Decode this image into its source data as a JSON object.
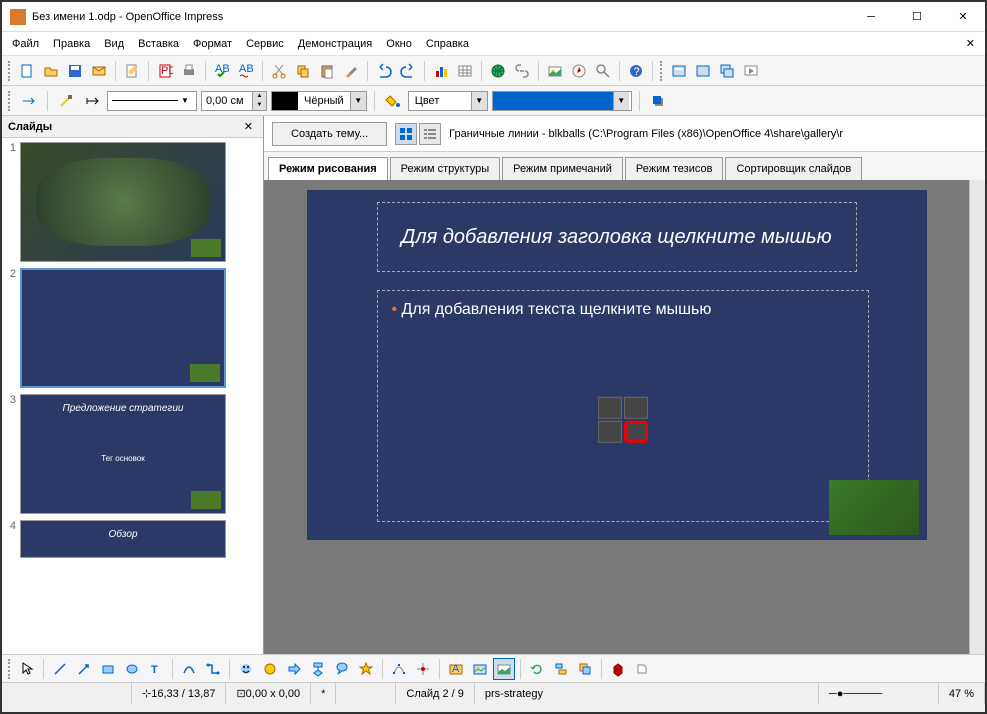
{
  "window": {
    "title": "Без имени 1.odp - OpenOffice Impress"
  },
  "menu": {
    "items": [
      "Файл",
      "Правка",
      "Вид",
      "Вставка",
      "Формат",
      "Сервис",
      "Демонстрация",
      "Окно",
      "Справка"
    ]
  },
  "toolbar1": {
    "icons": [
      "new",
      "open",
      "save",
      "mail",
      "edit",
      "pdf",
      "print",
      "spell",
      "autospell",
      "cut",
      "copy",
      "paste",
      "brush",
      "undo",
      "redo",
      "chart",
      "table",
      "web",
      "hyperlink",
      "gallery",
      "nav",
      "zoom",
      "help",
      "slide1",
      "slide2",
      "slide3",
      "presentation"
    ]
  },
  "toolbar2": {
    "arrow_icon": "arrow-end",
    "line_icon": "line-color",
    "width": "0,00 см",
    "color_label": "Чёрный",
    "bucket_icon": "fill",
    "fill_type": "Цвет",
    "shadow_icon": "shadow"
  },
  "slides_panel": {
    "title": "Слайды"
  },
  "thumbs": [
    {
      "num": "1",
      "type": "image"
    },
    {
      "num": "2",
      "type": "blank",
      "selected": true
    },
    {
      "num": "3",
      "title": "Предложение стратегии",
      "sub": "Тег основок"
    },
    {
      "num": "4",
      "title": "Обзор"
    }
  ],
  "editor": {
    "theme_btn": "Создать тему...",
    "path": "Граничные линии - blkballs (C:\\Program Files (x86)\\OpenOffice 4\\share\\gallery\\r",
    "tabs": [
      "Режим рисования",
      "Режим структуры",
      "Режим примечаний",
      "Режим тезисов",
      "Сортировщик слайдов"
    ],
    "title_placeholder": "Для добавления заголовка щелкните мышью",
    "body_placeholder": "Для добавления текста щелкните мышью"
  },
  "bottom_icons": [
    "select",
    "line",
    "arrow",
    "rect",
    "ellipse",
    "text",
    "curve",
    "connector",
    "shapes",
    "symbol",
    "arrows2",
    "flow",
    "callout",
    "star",
    "points",
    "glue",
    "fontwork",
    "fromfile",
    "gallery2",
    "rotate",
    "align",
    "arrange",
    "3d",
    "toggle"
  ],
  "status": {
    "pos": "16,33 / 13,87",
    "size": "0,00 x 0,00",
    "mark": "*",
    "slide": "Слайд 2 / 9",
    "template": "prs-strategy",
    "zoom": "47 %"
  },
  "colors": {
    "slide_bg": "#2c3966",
    "highlight": "#e00000"
  }
}
